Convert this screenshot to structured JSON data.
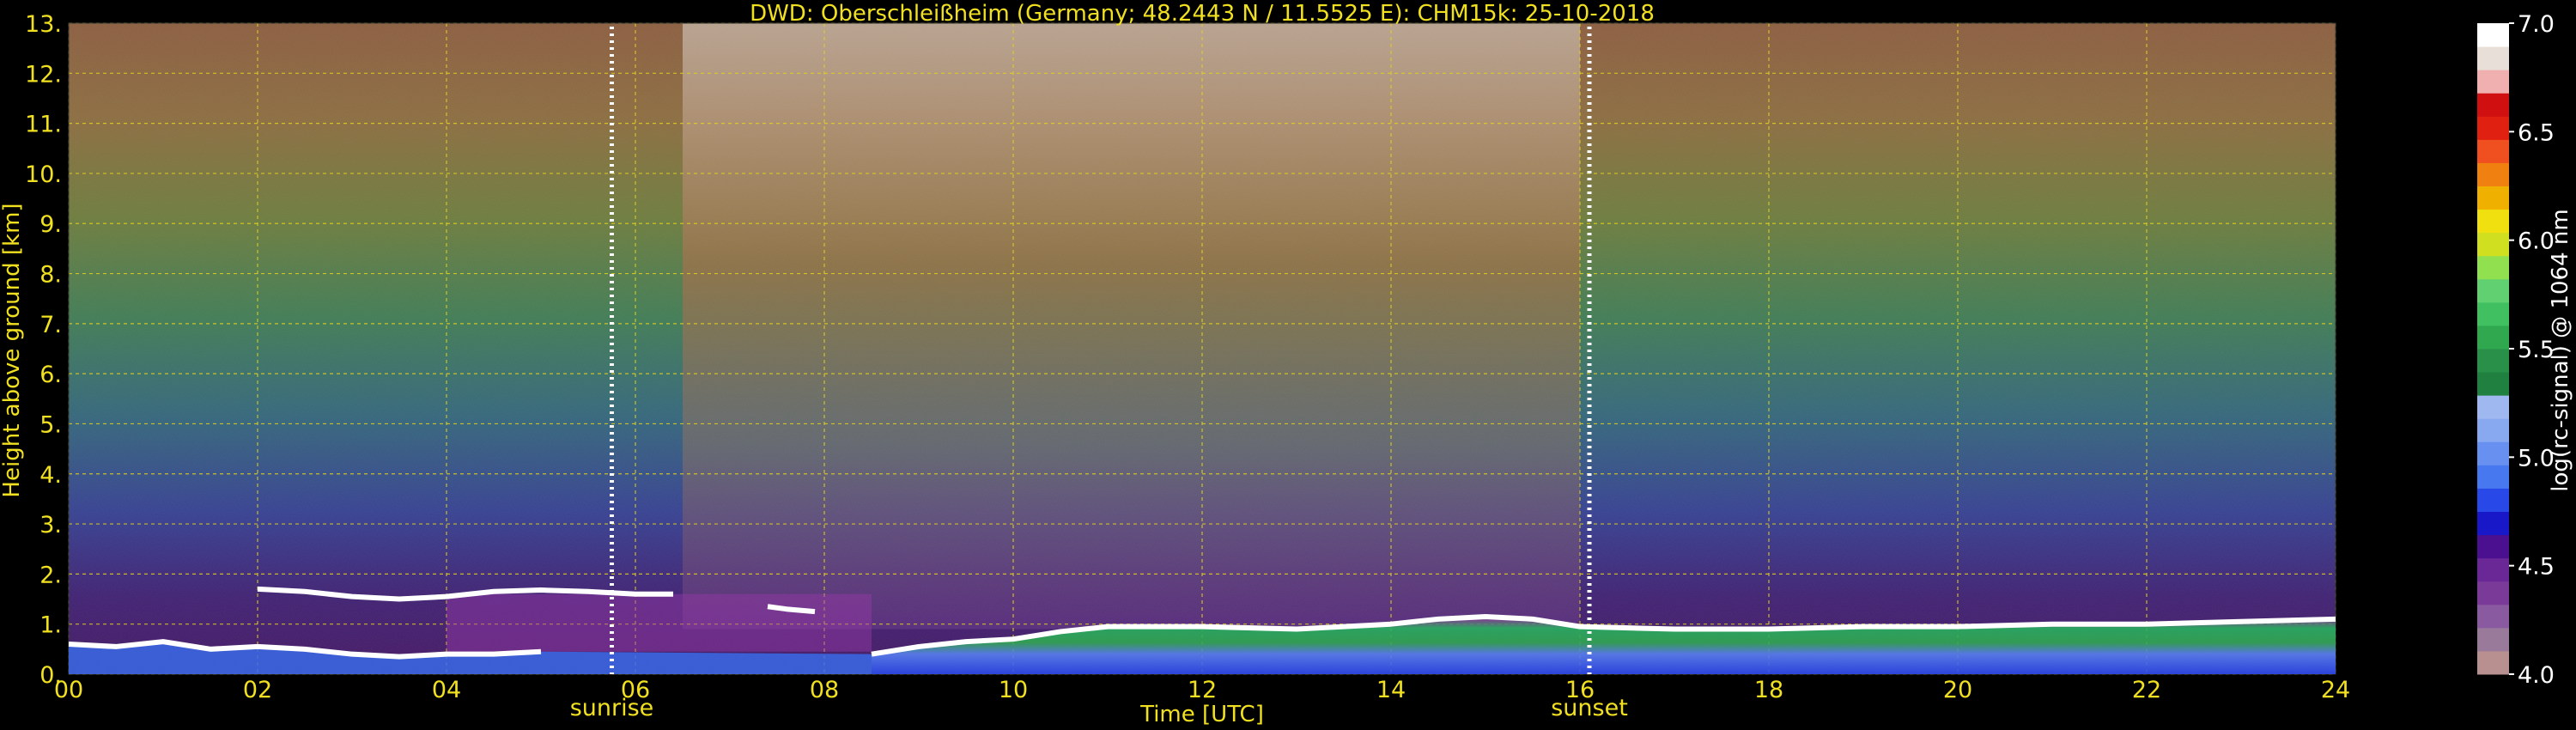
{
  "chart_data": {
    "type": "heatmap",
    "title": "DWD: Oberschleißheim (Germany; 48.2443 N / 11.5525 E):    CHM15k: 25-10-2018",
    "xlabel": "Time [UTC]",
    "ylabel": "Height above ground [km]",
    "xlim": [
      0,
      24
    ],
    "ylim": [
      0,
      13
    ],
    "x_ticks": [
      "00",
      "02",
      "04",
      "06",
      "08",
      "10",
      "12",
      "14",
      "16",
      "18",
      "20",
      "22",
      "24"
    ],
    "y_ticks": [
      "0.",
      "1.",
      "2.",
      "3.",
      "4.",
      "5.",
      "6.",
      "7.",
      "8.",
      "9.",
      "10.",
      "11.",
      "12.",
      "13."
    ],
    "grid": true,
    "annotations": [
      {
        "label": "sunrise",
        "x": 5.75
      },
      {
        "label": "sunset",
        "x": 16.1
      }
    ],
    "colorbar": {
      "label": "log(rc-signal) @ 1064 nm",
      "range": [
        4.0,
        7.0
      ],
      "ticks": [
        "4.0",
        "4.5",
        "5.0",
        "5.5",
        "6.0",
        "6.5",
        "7.0"
      ],
      "colors": [
        "#b89090",
        "#9a7a9a",
        "#8a5aa0",
        "#7a3a98",
        "#6a2896",
        "#4a1090",
        "#1818c8",
        "#2848e8",
        "#4878f0",
        "#6890f0",
        "#88a8f0",
        "#a0b8f0",
        "#208040",
        "#289048",
        "#30a850",
        "#40c060",
        "#60d070",
        "#90e050",
        "#d0e020",
        "#f0e010",
        "#f0b000",
        "#f08010",
        "#f05020",
        "#e02010",
        "#d01010",
        "#f0b0b0",
        "#e8e0d8",
        "#ffffff"
      ]
    },
    "cloud_layers": [
      {
        "name": "",
        "points": [
          [
            0.0,
            0.6
          ],
          [
            0.5,
            0.55
          ],
          [
            1.0,
            0.65
          ],
          [
            1.5,
            0.5
          ],
          [
            2.0,
            0.55
          ],
          [
            2.5,
            0.5
          ],
          [
            3.0,
            0.4
          ],
          [
            3.5,
            0.35
          ],
          [
            4.0,
            0.4
          ],
          [
            4.5,
            0.4
          ],
          [
            5.0,
            0.45
          ]
        ]
      },
      {
        "name": "",
        "points": [
          [
            2.0,
            1.7
          ],
          [
            2.5,
            1.65
          ],
          [
            3.0,
            1.55
          ],
          [
            3.5,
            1.5
          ],
          [
            4.0,
            1.55
          ],
          [
            4.5,
            1.65
          ],
          [
            5.0,
            1.68
          ],
          [
            5.5,
            1.65
          ],
          [
            6.0,
            1.6
          ],
          [
            6.4,
            1.6
          ]
        ]
      },
      {
        "name": "",
        "points": [
          [
            7.4,
            1.35
          ],
          [
            7.6,
            1.3
          ],
          [
            7.9,
            1.25
          ]
        ]
      },
      {
        "name": "",
        "points": [
          [
            8.5,
            0.4
          ],
          [
            9.0,
            0.55
          ],
          [
            9.5,
            0.65
          ],
          [
            10.0,
            0.7
          ],
          [
            10.5,
            0.85
          ],
          [
            11.0,
            0.95
          ],
          [
            12.0,
            0.95
          ],
          [
            13.0,
            0.9
          ],
          [
            13.5,
            0.95
          ],
          [
            14.0,
            1.0
          ],
          [
            14.5,
            1.1
          ],
          [
            15.0,
            1.15
          ],
          [
            15.5,
            1.1
          ],
          [
            16.0,
            0.95
          ],
          [
            17.0,
            0.9
          ],
          [
            18.0,
            0.9
          ],
          [
            19.0,
            0.95
          ],
          [
            20.0,
            0.95
          ],
          [
            21.0,
            1.0
          ],
          [
            22.0,
            1.0
          ],
          [
            23.0,
            1.05
          ],
          [
            24.0,
            1.1
          ]
        ]
      }
    ]
  }
}
